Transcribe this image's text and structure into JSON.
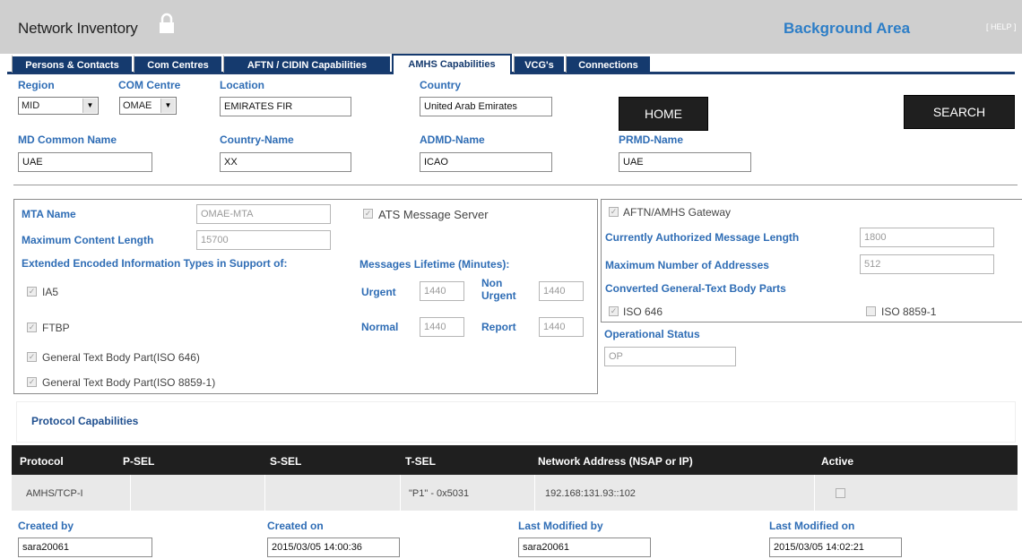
{
  "header": {
    "title": "Network Inventory",
    "background_area": "Background Area",
    "help": "[ HELP ]"
  },
  "tabs": [
    {
      "label": "Persons & Contacts",
      "active": false
    },
    {
      "label": "Com Centres",
      "active": false
    },
    {
      "label": "AFTN / CIDIN Capabilities",
      "active": false
    },
    {
      "label": "AMHS Capabilities",
      "active": true
    },
    {
      "label": "VCG's",
      "active": false
    },
    {
      "label": "Connections",
      "active": false
    }
  ],
  "filters": {
    "region_label": "Region",
    "region_value": "MID",
    "com_centre_label": "COM Centre",
    "com_centre_value": "OMAE",
    "location_label": "Location",
    "location_value": "EMIRATES FIR",
    "country_label": "Country",
    "country_value": "United Arab Emirates",
    "md_common_name_label": "MD Common Name",
    "md_common_name_value": "UAE",
    "country_name_label": "Country-Name",
    "country_name_value": "XX",
    "admd_name_label": "ADMD-Name",
    "admd_name_value": "ICAO",
    "prmd_name_label": "PRMD-Name",
    "prmd_name_value": "UAE"
  },
  "buttons": {
    "home": "HOME",
    "search": "SEARCH"
  },
  "mta": {
    "mta_name_label": "MTA Name",
    "mta_name_value": "OMAE-MTA",
    "ats_label": "ATS Message Server",
    "max_content_label": "Maximum Content Length",
    "max_content_value": "15700",
    "eit_label": "Extended Encoded Information Types in Support of:",
    "lifetime_label": "Messages Lifetime (Minutes):",
    "ia5": "IA5",
    "ftbp": "FTBP",
    "gtbp646": "General Text Body Part(ISO 646)",
    "gtbp8859": "General Text Body Part(ISO 8859-1)",
    "urgent_label": "Urgent",
    "urgent_value": "1440",
    "non_urgent_label_1": "Non",
    "non_urgent_label_2": "Urgent",
    "non_urgent_value": "1440",
    "normal_label": "Normal",
    "normal_value": "1440",
    "report_label": "Report",
    "report_value": "1440"
  },
  "gateway": {
    "gateway_label": "AFTN/AMHS Gateway",
    "auth_len_label": "Currently Authorized Message Length",
    "auth_len_value": "1800",
    "max_addr_label": "Maximum Number of Addresses",
    "max_addr_value": "512",
    "converted_label": "Converted General-Text Body Parts",
    "iso646": "ISO 646",
    "iso8859": "ISO 8859-1",
    "op_status_label": "Operational Status",
    "op_status_value": "OP"
  },
  "protocol": {
    "title": "Protocol Capabilities",
    "columns": [
      "Protocol",
      "P-SEL",
      "S-SEL",
      "T-SEL",
      "Network Address (NSAP or IP)",
      "Active"
    ],
    "row": [
      "AMHS/TCP-I",
      "",
      "",
      "\"P1\" - 0x5031",
      "192.168:131.93::102",
      ""
    ]
  },
  "footer": {
    "created_by_label": "Created by",
    "created_by_value": "sara20061",
    "created_on_label": "Created on",
    "created_on_value": "2015/03/05 14:00:36",
    "modified_by_label": "Last Modified by",
    "modified_by_value": "sara20061",
    "modified_on_label": "Last Modified on",
    "modified_on_value": "2015/03/05 14:02:21"
  }
}
